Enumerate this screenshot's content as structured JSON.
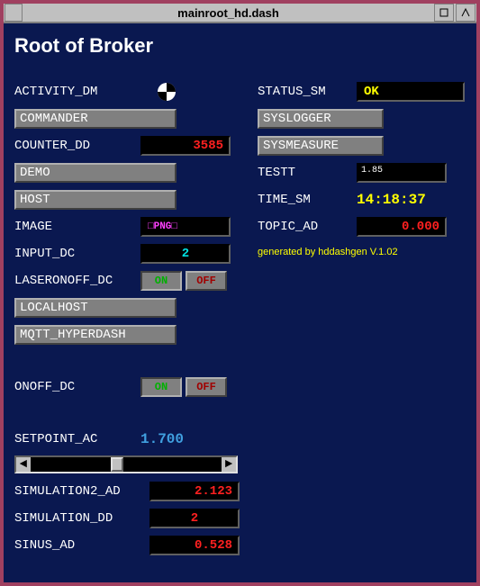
{
  "window": {
    "title": "mainroot_hd.dash"
  },
  "page": {
    "title": "Root of Broker"
  },
  "left": {
    "activity_label": "ACTIVITY_DM",
    "commander": "COMMANDER",
    "counter_label": "COUNTER_DD",
    "counter_value": "3585",
    "demo": "DEMO",
    "host": "HOST",
    "image_label": "IMAGE",
    "image_value": "□PNG□",
    "input_label": "INPUT_DC",
    "input_value": "2",
    "laser_label": "LASERONOFF_DC",
    "on": "ON",
    "off": "OFF",
    "localhost": "LOCALHOST",
    "mqtt": "MQTT_HYPERDASH",
    "onoff_label": "ONOFF_DC",
    "setpoint_label": "SETPOINT_AC",
    "setpoint_value": "1.700",
    "sim2_label": "SIMULATION2_AD",
    "sim2_value": "2.123",
    "simdd_label": "SIMULATION_DD",
    "simdd_value": "2",
    "sinus_label": "SINUS_AD",
    "sinus_value": "0.528"
  },
  "right": {
    "status_label": "STATUS_SM",
    "status_value": "OK",
    "syslogger": "SYSLOGGER",
    "sysmeasure": "SYSMEASURE",
    "testt_label": "TESTT",
    "testt_value": "1.85",
    "time_label": "TIME_SM",
    "time_value": "14:18:37",
    "topic_label": "TOPIC_AD",
    "topic_value": "0.000",
    "gen_note": "generated by hddashgen V.1.02"
  }
}
